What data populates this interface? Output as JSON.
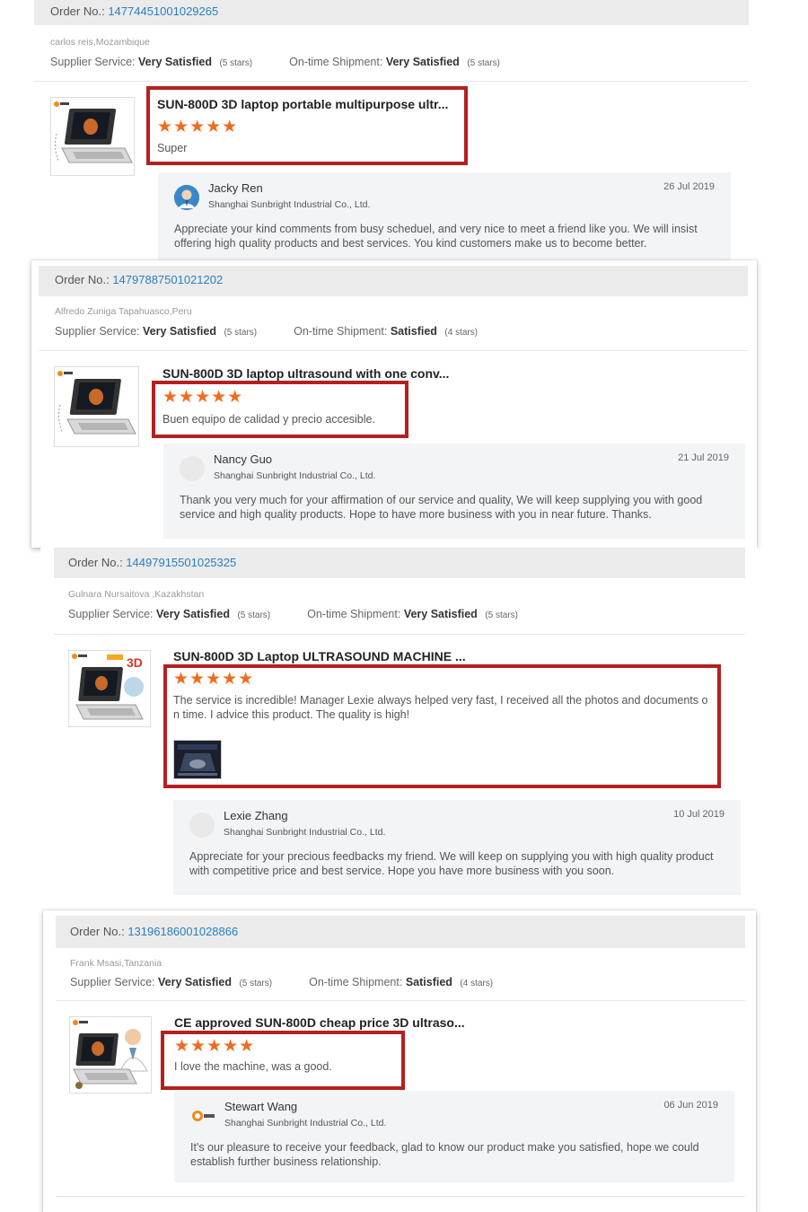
{
  "reviews": [
    {
      "order_label": "Order No.:",
      "order_no": "14774451001029265",
      "buyer": "carlos reis,Mozambique",
      "supplier_label": "Supplier Service:",
      "supplier_value": "Very Satisfied",
      "supplier_stars": "(5 stars)",
      "shipment_label": "On-time Shipment:",
      "shipment_value": "Very Satisfied",
      "shipment_stars": "(5 stars)",
      "product_title": "SUN-800D 3D laptop portable multipurpose ultr...",
      "rating": 5,
      "stars": "★★★★★",
      "review_text": "Super",
      "reply": {
        "name": "Jacky Ren",
        "company": "Shanghai Sunbright Industrial Co., Ltd.",
        "date": "26 Jul 2019",
        "message": "Appreciate your kind comments from busy scheduel, and very nice to meet a friend like you. We will insist offering high quality products and best services. You kind customers make us to become better."
      }
    },
    {
      "order_label": "Order No.:",
      "order_no": "14797887501021202",
      "buyer": "Alfredo Zuniga Tapahuasco,Peru",
      "supplier_label": "Supplier Service:",
      "supplier_value": "Very Satisfied",
      "supplier_stars": "(5 stars)",
      "shipment_label": "On-time Shipment:",
      "shipment_value": "Satisfied",
      "shipment_stars": "(4 stars)",
      "product_title": "SUN-800D 3D laptop ultrasound with one conv...",
      "rating": 5,
      "stars": "★★★★★",
      "review_text": "Buen equipo de calidad y precio accesible.",
      "reply": {
        "name": "Nancy Guo",
        "company": "Shanghai Sunbright Industrial Co., Ltd.",
        "date": "21 Jul 2019",
        "message": "Thank you very much for your affirmation of our service and quality, We will keep supplying you with good service and high quality products. Hope to have more business with you in near future. Thanks."
      }
    },
    {
      "order_label": "Order No.:",
      "order_no": "14497915501025325",
      "buyer": "Gulnara Nursaitova ,Kazakhstan",
      "supplier_label": "Supplier Service:",
      "supplier_value": "Very Satisfied",
      "supplier_stars": "(5 stars)",
      "shipment_label": "On-time Shipment:",
      "shipment_value": "Very Satisfied",
      "shipment_stars": "(5 stars)",
      "product_title": "SUN-800D 3D Laptop ULTRASOUND MACHINE ...",
      "rating": 5,
      "stars": "★★★★★",
      "review_text": "The service is incredible! Manager Lexie always helped very fast, I received all the photos and documents o n time. I advice this product. The quality is high!",
      "reply": {
        "name": "Lexie Zhang",
        "company": "Shanghai Sunbright Industrial Co., Ltd.",
        "date": "10 Jul 2019",
        "message": "Appreciate for your precious feedbacks my friend. We will keep on supplying you with high quality product with competitive price and best service. Hope you have more business with you soon."
      }
    },
    {
      "order_label": "Order No.:",
      "order_no": "13196186001028866",
      "buyer": "Frank Msasi,Tanzania",
      "supplier_label": "Supplier Service:",
      "supplier_value": "Very Satisfied",
      "supplier_stars": "(5 stars)",
      "shipment_label": "On-time Shipment:",
      "shipment_value": "Satisfied",
      "shipment_stars": "(4 stars)",
      "product_title": "CE approved SUN-800D cheap price 3D ultraso...",
      "rating": 5,
      "stars": "★★★★★",
      "review_text": "I love the machine, was a good.",
      "reply": {
        "name": "Stewart Wang",
        "company": "Shanghai Sunbright Industrial Co., Ltd.",
        "date": "06 Jun 2019",
        "message": "It's our pleasure to receive your feedback, glad to know our product make you satisfied, hope we could establish further business relationship."
      }
    }
  ],
  "colors": {
    "order_link": "#2a7fc1",
    "star": "#f26b1d",
    "highlight_box": "#b3201f",
    "reply_bg": "#f3f4f6",
    "order_bar_bg": "#ebebeb"
  }
}
